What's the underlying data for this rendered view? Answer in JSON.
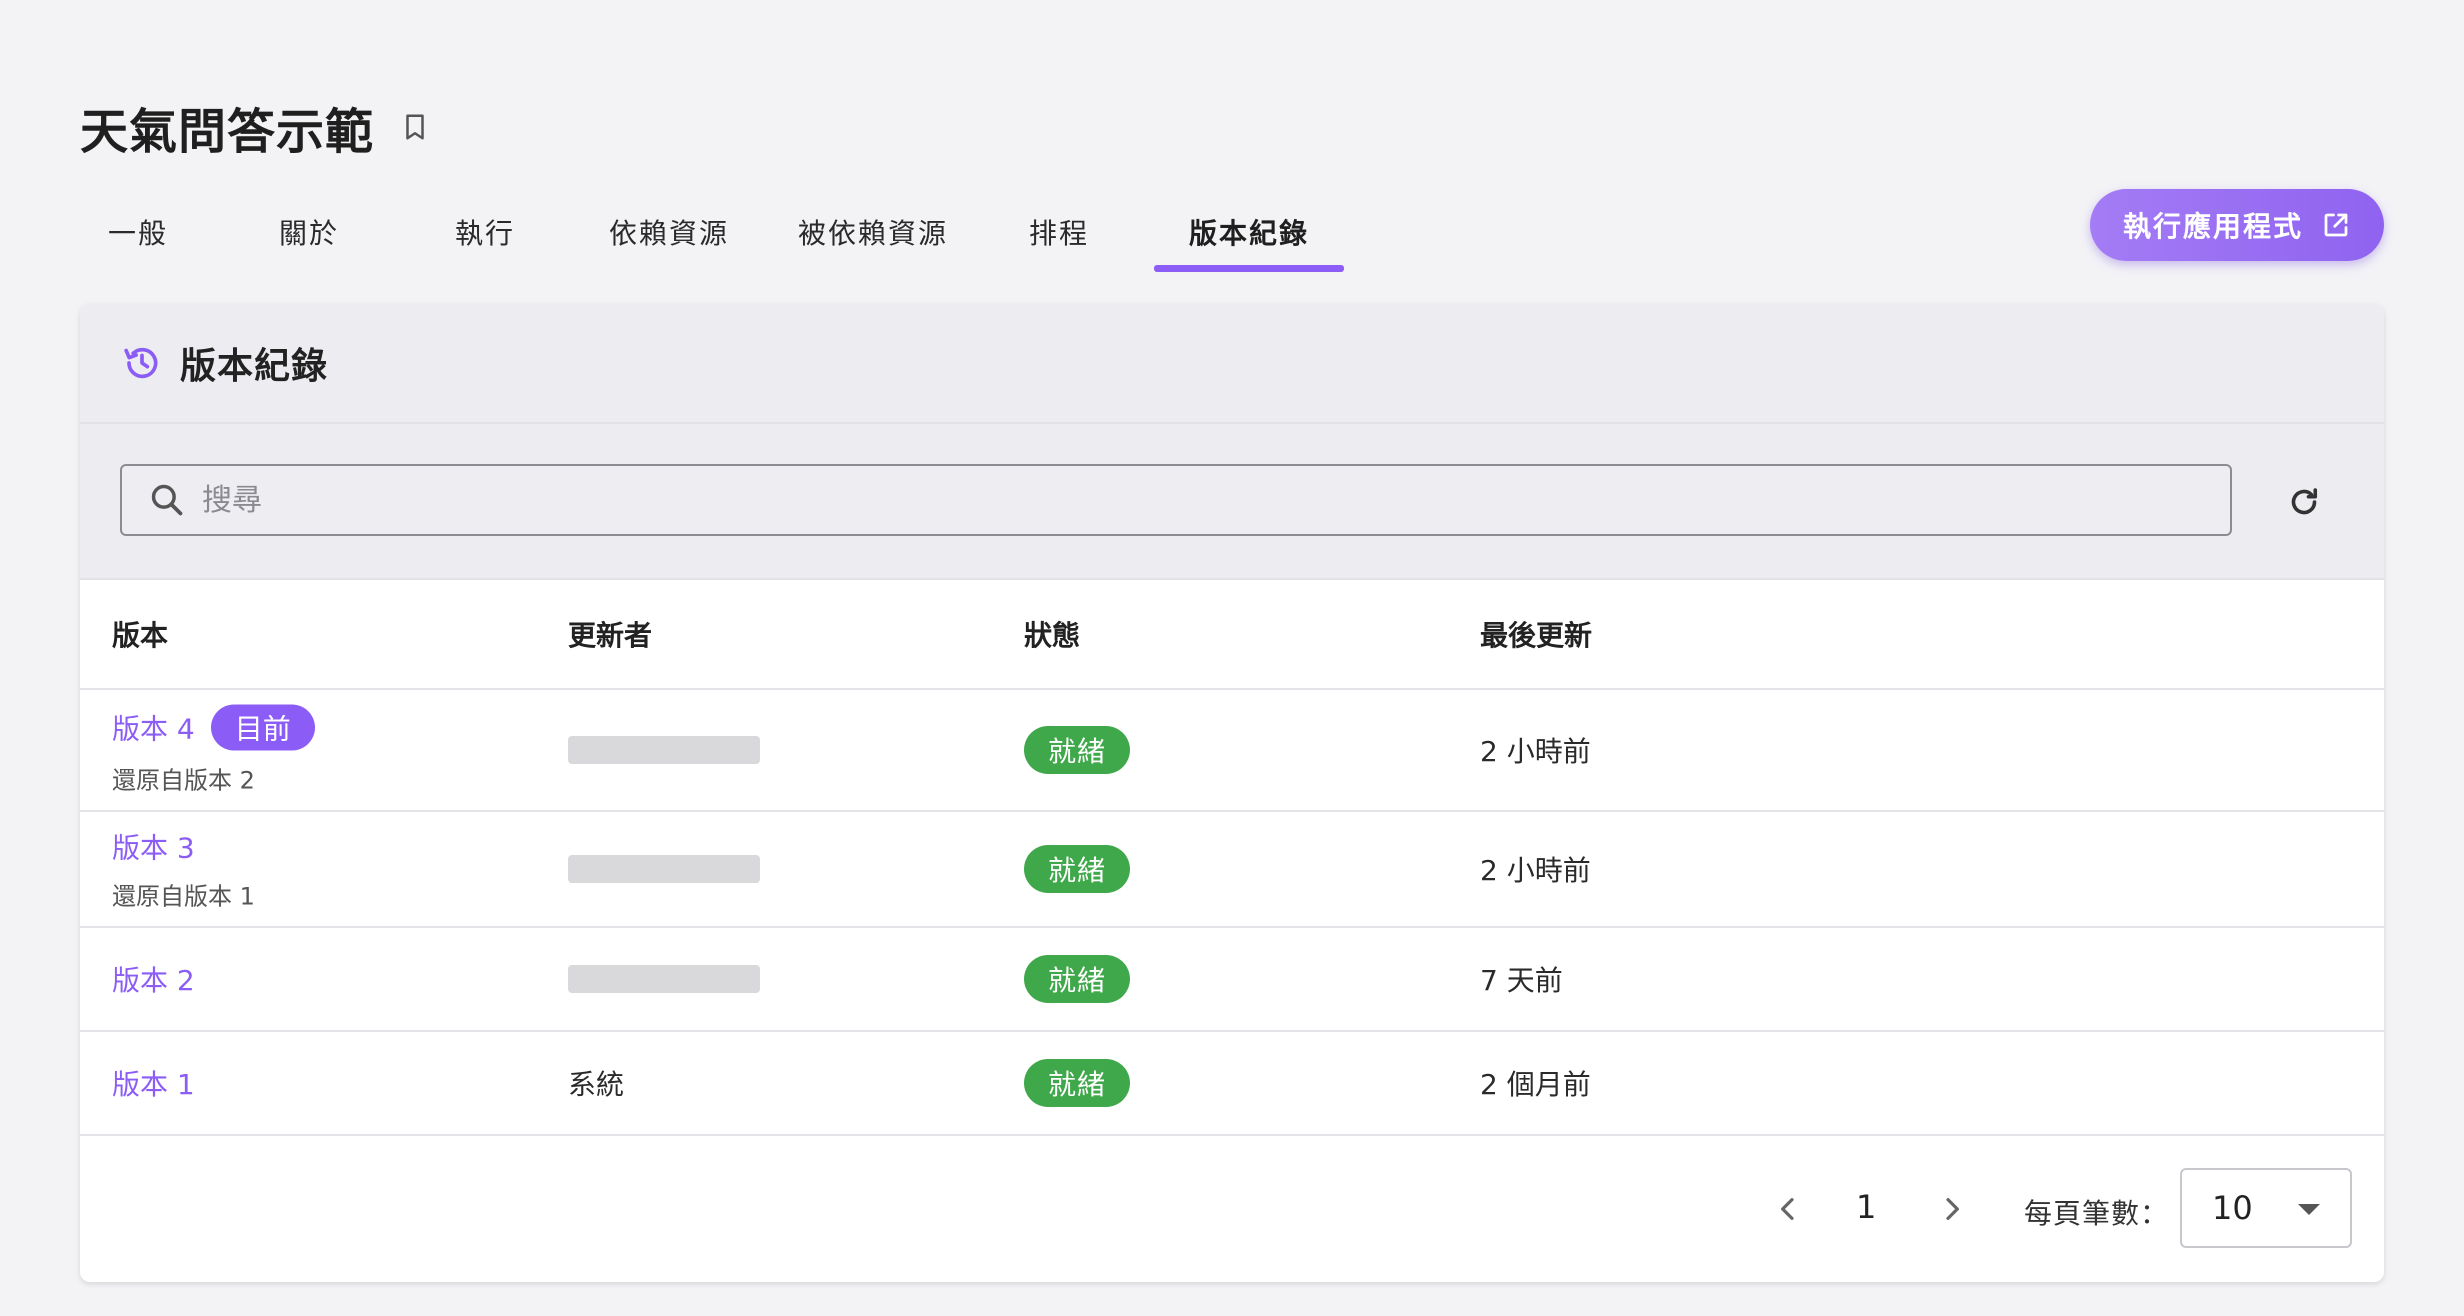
{
  "page": {
    "title": "天氣問答示範"
  },
  "tabs": [
    {
      "label": "一般"
    },
    {
      "label": "關於"
    },
    {
      "label": "執行"
    },
    {
      "label": "依賴資源"
    },
    {
      "label": "被依賴資源"
    },
    {
      "label": "排程"
    },
    {
      "label": "版本紀錄",
      "active": true
    }
  ],
  "run_button": {
    "label": "執行應用程式",
    "icon": "open-in-new-icon"
  },
  "card": {
    "title": "版本紀錄",
    "icon": "history-icon"
  },
  "search": {
    "placeholder": "搜尋"
  },
  "table": {
    "headers": [
      "版本",
      "更新者",
      "狀態",
      "最後更新"
    ],
    "rows": [
      {
        "version": "版本 4",
        "badge": "目前",
        "note": "還原自版本 2",
        "updater": "",
        "status": "就緒",
        "updated": "2 小時前"
      },
      {
        "version": "版本 3",
        "note": "還原自版本 1",
        "updater": "",
        "status": "就緒",
        "updated": "2 小時前"
      },
      {
        "version": "版本 2",
        "updater": "",
        "status": "就緒",
        "updated": "7 天前"
      },
      {
        "version": "版本 1",
        "updater": "系統",
        "status": "就緒",
        "updated": "2 個月前"
      }
    ]
  },
  "pagination": {
    "current_page": "1",
    "per_page_label": "每頁筆數：",
    "per_page_value": "10"
  },
  "colors": {
    "accent": "#8b5cf6",
    "status_ready": "#3fa84a"
  }
}
